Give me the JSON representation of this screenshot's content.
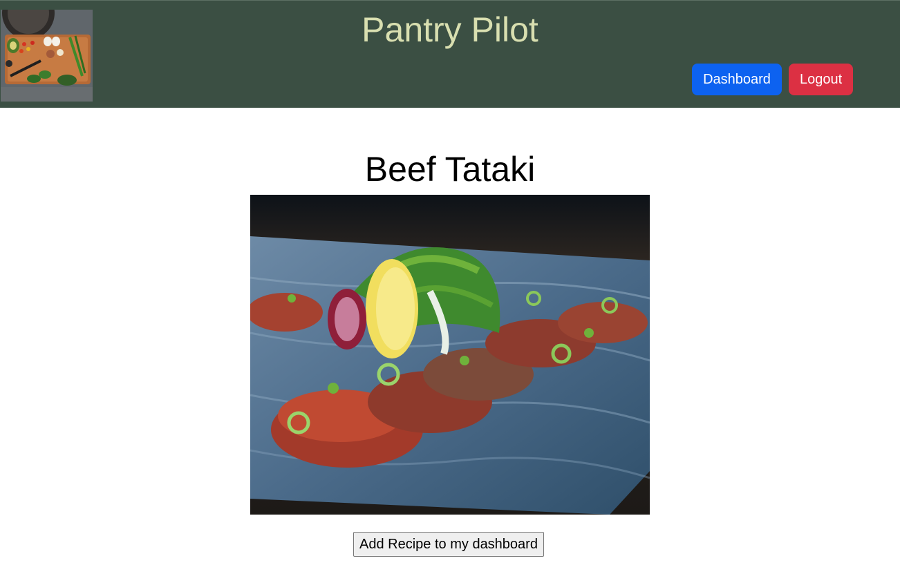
{
  "header": {
    "brand_title": "Pantry Pilot",
    "logo_icon": "cutting-board-vegetables-photo",
    "nav": {
      "dashboard_label": "Dashboard",
      "logout_label": "Logout"
    },
    "colors": {
      "background": "#3b4f43",
      "brand_text": "#d9dfb0",
      "dashboard_button": "#0d62f0",
      "logout_button": "#dc3043"
    }
  },
  "recipe": {
    "title": "Beef Tataki",
    "image_icon": "beef-tataki-photo",
    "add_button_label": "Add Recipe to my dashboard"
  }
}
